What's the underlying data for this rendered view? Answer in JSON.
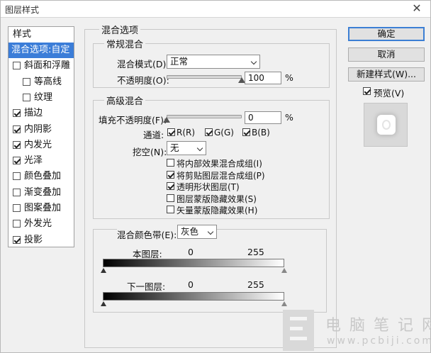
{
  "window": {
    "title": "图层样式",
    "close_symbol": "✕"
  },
  "styles_panel": {
    "header": "样式",
    "items": [
      {
        "label": "混合选项:自定",
        "selected": true,
        "checkbox": false
      },
      {
        "label": "斜面和浮雕",
        "checkbox": true,
        "checked": false
      },
      {
        "label": "等高线",
        "checkbox": true,
        "checked": false,
        "indent": true
      },
      {
        "label": "纹理",
        "checkbox": true,
        "checked": false,
        "indent": true
      },
      {
        "label": "描边",
        "checkbox": true,
        "checked": true
      },
      {
        "label": "内阴影",
        "checkbox": true,
        "checked": true
      },
      {
        "label": "内发光",
        "checkbox": true,
        "checked": true
      },
      {
        "label": "光泽",
        "checkbox": true,
        "checked": true
      },
      {
        "label": "颜色叠加",
        "checkbox": true,
        "checked": false
      },
      {
        "label": "渐变叠加",
        "checkbox": true,
        "checked": false
      },
      {
        "label": "图案叠加",
        "checkbox": true,
        "checked": false
      },
      {
        "label": "外发光",
        "checkbox": true,
        "checked": false
      },
      {
        "label": "投影",
        "checkbox": true,
        "checked": true
      }
    ]
  },
  "blending": {
    "section_title": "混合选项",
    "general": {
      "title": "常规混合",
      "mode_label": "混合模式(D):",
      "mode_value": "正常",
      "opacity_label": "不透明度(O):",
      "opacity_value": "100",
      "opacity_fraction": 1.0,
      "percent": "%"
    },
    "advanced": {
      "title": "高级混合",
      "fill_label": "填充不透明度(F):",
      "fill_value": "0",
      "fill_fraction": 0.0,
      "percent": "%",
      "channels_label": "通道:",
      "channels": [
        {
          "label": "R(R)",
          "checked": true
        },
        {
          "label": "G(G)",
          "checked": true
        },
        {
          "label": "B(B)",
          "checked": true
        }
      ],
      "knockout_label": "挖空(N):",
      "knockout_value": "无",
      "options": [
        {
          "label": "将内部效果混合成组(I)",
          "checked": false
        },
        {
          "label": "将剪贴图层混合成组(P)",
          "checked": true
        },
        {
          "label": "透明形状图层(T)",
          "checked": true
        },
        {
          "label": "图层蒙版隐藏效果(S)",
          "checked": false
        },
        {
          "label": "矢量蒙版隐藏效果(H)",
          "checked": false
        }
      ]
    },
    "blend_if": {
      "label": "混合颜色带(E):",
      "value": "灰色",
      "this_layer_label": "本图层:",
      "this_layer_min": "0",
      "this_layer_max": "255",
      "underlying_label": "下一图层:",
      "underlying_min": "0",
      "underlying_max": "255"
    }
  },
  "buttons": {
    "ok": "确定",
    "cancel": "取消",
    "new_style": "新建样式(W)...",
    "preview_label": "预览(V)",
    "preview_checked": true
  },
  "watermark": {
    "text": "电脑笔记网",
    "url": "www.pcbiji.com"
  }
}
